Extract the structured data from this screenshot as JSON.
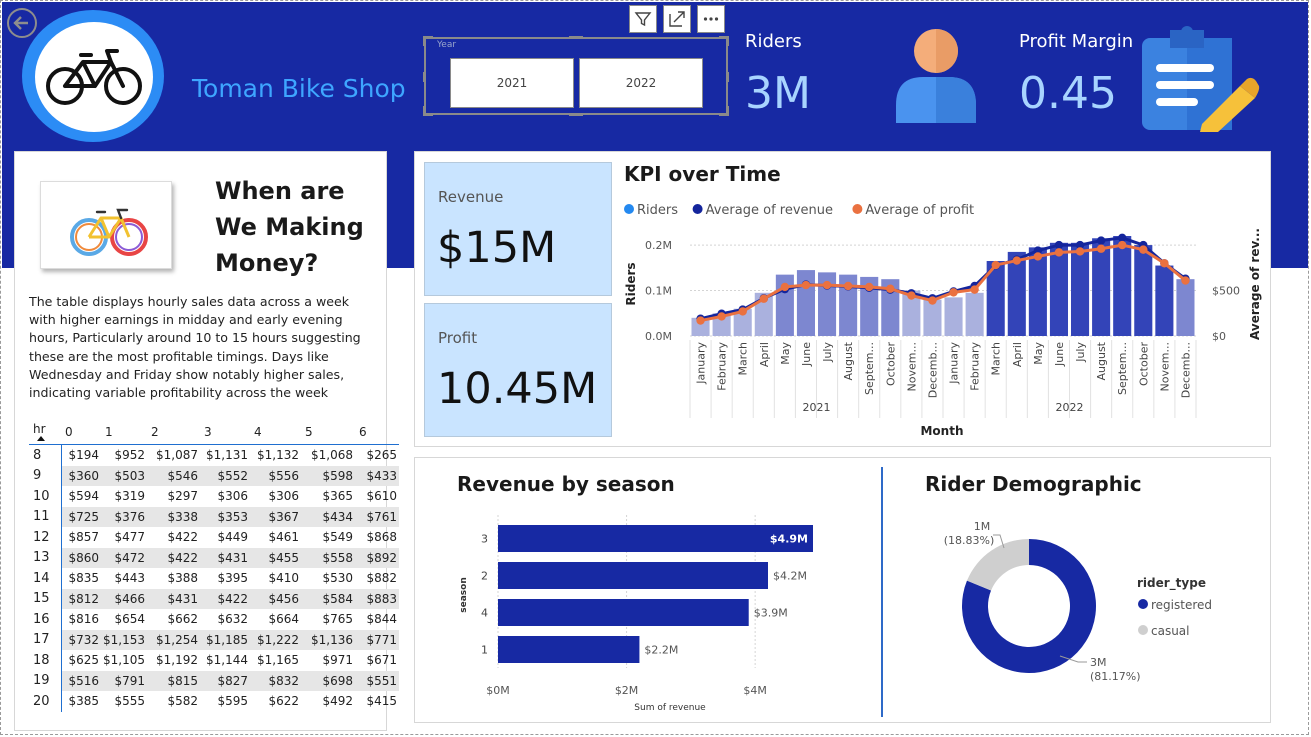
{
  "header": {
    "shop_title": "Toman Bike Shop",
    "slicer_label": "Year",
    "slicer_options": [
      "2021",
      "2022"
    ],
    "toolbar_icons": [
      "filter-icon",
      "focus-mode-icon",
      "more-options-icon"
    ],
    "riders_label": "Riders",
    "riders_value": "3M",
    "profit_margin_label": "Profit Margin",
    "profit_margin_value": "0.45"
  },
  "left_panel": {
    "title": "When are We Making Money?",
    "description": "The table displays hourly sales data across a week with higher earnings in midday and early evening hours, Particularly around 10 to 15 hours suggesting these are the most profitable timings. Days like Wednesday and Friday show  notably higher sales, indicating variable profitability across the week",
    "table": {
      "corner": "hr",
      "columns": [
        "0",
        "1",
        "2",
        "3",
        "4",
        "5",
        "6"
      ],
      "rows": [
        {
          "hr": "8",
          "values": [
            "$194",
            "$952",
            "$1,087",
            "$1,131",
            "$1,132",
            "$1,068",
            "$265"
          ]
        },
        {
          "hr": "9",
          "values": [
            "$360",
            "$503",
            "$546",
            "$552",
            "$556",
            "$598",
            "$433"
          ]
        },
        {
          "hr": "10",
          "values": [
            "$594",
            "$319",
            "$297",
            "$306",
            "$306",
            "$365",
            "$610"
          ]
        },
        {
          "hr": "11",
          "values": [
            "$725",
            "$376",
            "$338",
            "$353",
            "$367",
            "$434",
            "$761"
          ]
        },
        {
          "hr": "12",
          "values": [
            "$857",
            "$477",
            "$422",
            "$449",
            "$461",
            "$549",
            "$868"
          ]
        },
        {
          "hr": "13",
          "values": [
            "$860",
            "$472",
            "$422",
            "$431",
            "$455",
            "$558",
            "$892"
          ]
        },
        {
          "hr": "14",
          "values": [
            "$835",
            "$443",
            "$388",
            "$395",
            "$410",
            "$530",
            "$882"
          ]
        },
        {
          "hr": "15",
          "values": [
            "$812",
            "$466",
            "$431",
            "$422",
            "$456",
            "$584",
            "$883"
          ]
        },
        {
          "hr": "16",
          "values": [
            "$816",
            "$654",
            "$662",
            "$632",
            "$664",
            "$765",
            "$844"
          ]
        },
        {
          "hr": "17",
          "values": [
            "$732",
            "$1,153",
            "$1,254",
            "$1,185",
            "$1,222",
            "$1,136",
            "$771"
          ]
        },
        {
          "hr": "18",
          "values": [
            "$625",
            "$1,105",
            "$1,192",
            "$1,144",
            "$1,165",
            "$971",
            "$671"
          ]
        },
        {
          "hr": "19",
          "values": [
            "$516",
            "$791",
            "$815",
            "$827",
            "$832",
            "$698",
            "$551"
          ]
        },
        {
          "hr": "20",
          "values": [
            "$385",
            "$555",
            "$582",
            "$595",
            "$622",
            "$492",
            "$415"
          ]
        }
      ]
    }
  },
  "cards": {
    "revenue_label": "Revenue",
    "revenue_value": "$15M",
    "profit_label": "Profit",
    "profit_value": "10.45M"
  },
  "kpi_panel": {
    "title": "KPI over Time"
  },
  "season_panel": {
    "title": "Revenue by season"
  },
  "demographic_panel": {
    "title": "Rider Demographic"
  },
  "colors": {
    "header_bg": "#1729a3",
    "riders_bar": "#3344b8",
    "riders_bar_light": "#7d87d0",
    "revenue_line": "#14259c",
    "profit_line": "#ea7140",
    "riders_legend": "#2489f0",
    "donut_registered": "#1729a3",
    "donut_casual": "#cfcfcf",
    "season_bar": "#1729a3"
  },
  "chart_data": [
    {
      "type": "bar",
      "subtype": "bar-with-two-lines",
      "legend": [
        "Riders",
        "Average of revenue",
        "Average of profit"
      ],
      "legend_position": "top-left",
      "xlabel": "Month",
      "ylabel": "Riders",
      "y2label": "Average of rev...",
      "x_groups": [
        "2021",
        "2022"
      ],
      "categories": [
        "January",
        "February",
        "March",
        "April",
        "May",
        "June",
        "July",
        "August",
        "Septem...",
        "October",
        "Novem...",
        "Decemb...",
        "January",
        "February",
        "March",
        "April",
        "May",
        "June",
        "July",
        "August",
        "Septem...",
        "October",
        "Novem...",
        "Decemb..."
      ],
      "y_ticks": [
        "0.0M",
        "0.1M",
        "0.2M"
      ],
      "y_tick_values": [
        0,
        0.1,
        0.2
      ],
      "ylim": [
        0,
        0.22
      ],
      "y2_ticks": [
        "$0",
        "$500"
      ],
      "y2_tick_values": [
        0,
        500
      ],
      "y2lim": [
        0,
        1100
      ],
      "grid": true,
      "series": [
        {
          "name": "Riders",
          "axis": "left",
          "values": [
            0.04,
            0.05,
            0.06,
            0.095,
            0.135,
            0.145,
            0.14,
            0.135,
            0.13,
            0.125,
            0.1,
            0.08,
            0.085,
            0.095,
            0.165,
            0.185,
            0.195,
            0.205,
            0.205,
            0.215,
            0.22,
            0.2,
            0.155,
            0.125
          ]
        },
        {
          "name": "Average of revenue",
          "axis": "left",
          "values": [
            0.038,
            0.049,
            0.058,
            0.083,
            0.103,
            0.113,
            0.111,
            0.109,
            0.106,
            0.102,
            0.094,
            0.083,
            0.098,
            0.11,
            0.155,
            0.168,
            0.188,
            0.2,
            0.2,
            0.21,
            0.216,
            0.2,
            0.16,
            0.126
          ]
        },
        {
          "name": "Average of profit",
          "axis": "right",
          "values": [
            170,
            215,
            270,
            410,
            540,
            560,
            560,
            550,
            540,
            520,
            445,
            390,
            480,
            510,
            780,
            830,
            875,
            920,
            930,
            960,
            1000,
            950,
            800,
            610
          ]
        }
      ]
    },
    {
      "type": "bar",
      "orientation": "horizontal",
      "ylabel": "season",
      "xlabel": "Sum of revenue",
      "categories": [
        "3",
        "2",
        "4",
        "1"
      ],
      "values": [
        4.9,
        4.2,
        3.9,
        2.2
      ],
      "value_labels": [
        "$4.9M",
        "$4.2M",
        "$3.9M",
        "$2.2M"
      ],
      "x_ticks": [
        "$0M",
        "$2M",
        "$4M"
      ],
      "x_tick_values": [
        0,
        2,
        4
      ],
      "xlim": [
        0,
        4.9
      ]
    },
    {
      "type": "pie",
      "subtype": "donut",
      "legend_title": "rider_type",
      "legend_position": "right",
      "categories": [
        "registered",
        "casual"
      ],
      "values": [
        81.17,
        18.83
      ],
      "value_labels": [
        "3M",
        "1M"
      ],
      "percent_labels": [
        "(81.17%)",
        "(18.83%)"
      ]
    }
  ]
}
